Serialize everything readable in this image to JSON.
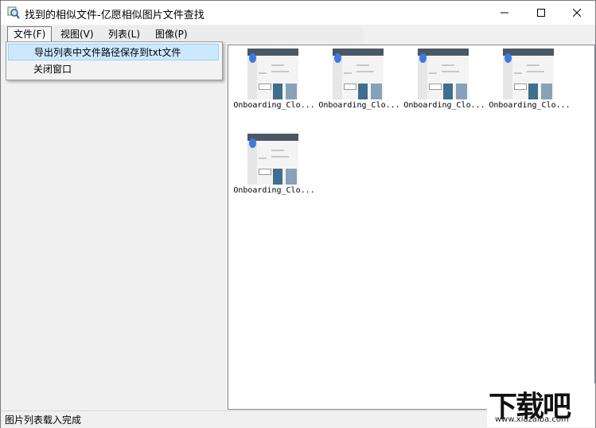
{
  "window": {
    "title": "找到的相似文件-亿愿相似图片文件查找",
    "icon": "magnifier-image-app-icon"
  },
  "menubar": {
    "items": [
      {
        "label": "文件(F)",
        "active": true
      },
      {
        "label": "视图(V)"
      },
      {
        "label": "列表(L)"
      },
      {
        "label": "图像(P)"
      }
    ]
  },
  "file_menu": {
    "items": [
      {
        "label": "导出列表中文件路径保存到txt文件",
        "highlighted": true
      },
      {
        "label": "关闭窗口"
      }
    ]
  },
  "thumbnails": [
    {
      "label": "Onboarding_Clo..."
    },
    {
      "label": "Onboarding_Clo..."
    },
    {
      "label": "Onboarding_Clo..."
    },
    {
      "label": "Onboarding_Clo..."
    },
    {
      "label": "Onboarding_Clo..."
    }
  ],
  "status": {
    "text": "图片列表载入完成"
  },
  "watermark": {
    "main": "下载吧",
    "sub": "www.xiazaiba.com"
  },
  "colors": {
    "highlight": "#cce8ff",
    "accent_blue": "#3f78e0",
    "thumb_bar": "#4a5863"
  }
}
